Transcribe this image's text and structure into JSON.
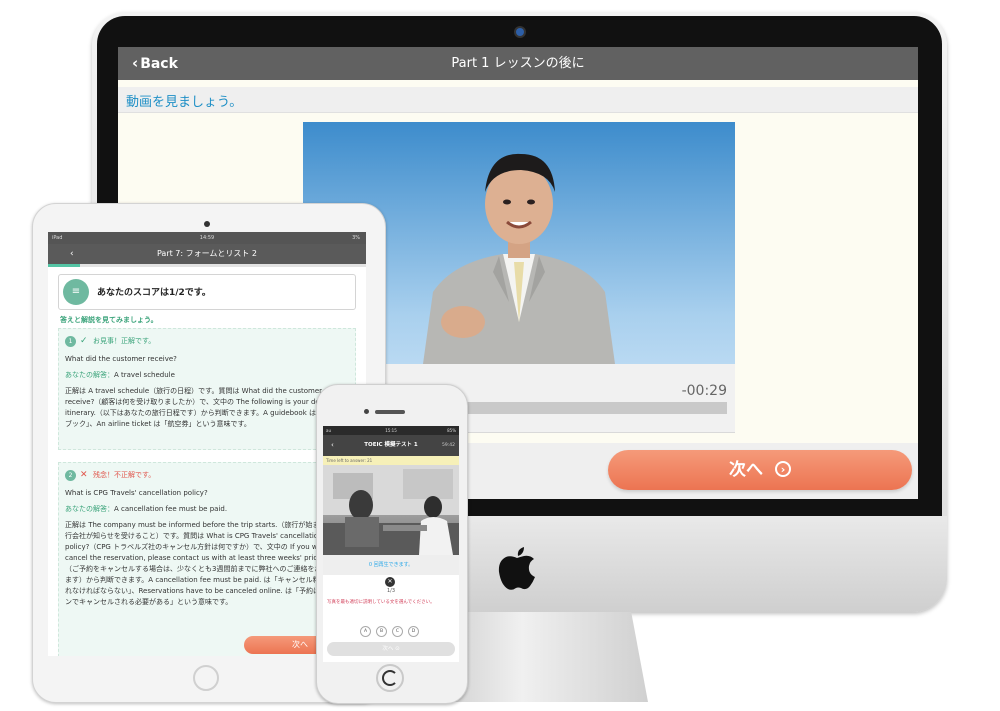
{
  "desktop": {
    "back_label": "Back",
    "title": "Part 1 レッスンの後に",
    "instruction": "動画を見ましょう。",
    "video": {
      "time_remaining": "-00:29",
      "progress_fraction": 0.35
    },
    "next_label": "次へ",
    "next_icon": "arrow-right-circle-icon"
  },
  "tablet": {
    "status": {
      "carrier": "iPad",
      "clock": "14:59",
      "battery": "3%"
    },
    "header": {
      "back_icon": "chevron-left-icon",
      "title": "Part 7: フォームとリスト 2"
    },
    "progress_fraction": 0.1,
    "score_text": "あなたのスコアは1/2です。",
    "review_heading": "答えと解説を見てみましょう。",
    "answers": [
      {
        "number": "1",
        "mark": "✓",
        "verdict": "お見事！正解です。",
        "question": "What did the customer receive?",
        "your_answer_label": "あなたの解答：",
        "your_answer": "A travel schedule",
        "explanation": "正解は A travel schedule（旅行の日程）です。質問は What did the customer receive?（顧客は何を受け取りましたか）で、文中の The following is your detailed itinerary.（以下はあなたの旅行日程です）から判断できます。A guidebook は「ガイドブック」、An airline ticket は「航空券」という意味です。"
      },
      {
        "number": "2",
        "mark": "✕",
        "verdict": "残念！不正解です。",
        "question": "What is CPG Travels' cancellation policy?",
        "your_answer_label": "あなたの解答：",
        "your_answer": "A cancellation fee must be paid.",
        "explanation": "正解は The company must be informed before the trip starts.（旅行が始まる前に旅行会社が知らせを受けること）です。質問は What is CPG Travels' cancellation policy?（CPG トラベルズ社のキャンセル方針は何ですか）で、文中の If you wish to cancel the reservation, please contact us with at least three weeks' prior notice.（ご予約をキャンセルする場合は、少なくとも3週間前までに弊社へのご連絡をお願いします）から判断できます。A cancellation fee must be paid. は「キャンセル料が支払われなければならない」、Reservations have to be canceled online. は「予約はオンラインでキャンセルされる必要がある」という意味です。"
      }
    ],
    "next_label": "次へ"
  },
  "phone": {
    "status": {
      "carrier": "au",
      "clock": "15:15",
      "battery": "85%"
    },
    "header": {
      "back_icon": "chevron-left-icon",
      "title": "TOEIC 模擬テスト 1",
      "timer": "59:42"
    },
    "time_left": "Time left to answer: 21",
    "replay_text": "0 回再生できます。",
    "close_icon": "close-icon",
    "page": "1/3",
    "instruction": "写真を最も適切に説明している文を選んでください。",
    "choices": [
      "A",
      "B",
      "C",
      "D"
    ],
    "next_label": "次へ"
  },
  "colors": {
    "accent_blue": "#2aa8e8",
    "next_orange": "#ec7452",
    "correct_green": "#3aa37a",
    "wrong_red": "#e0544a",
    "header_gray": "#616161"
  }
}
